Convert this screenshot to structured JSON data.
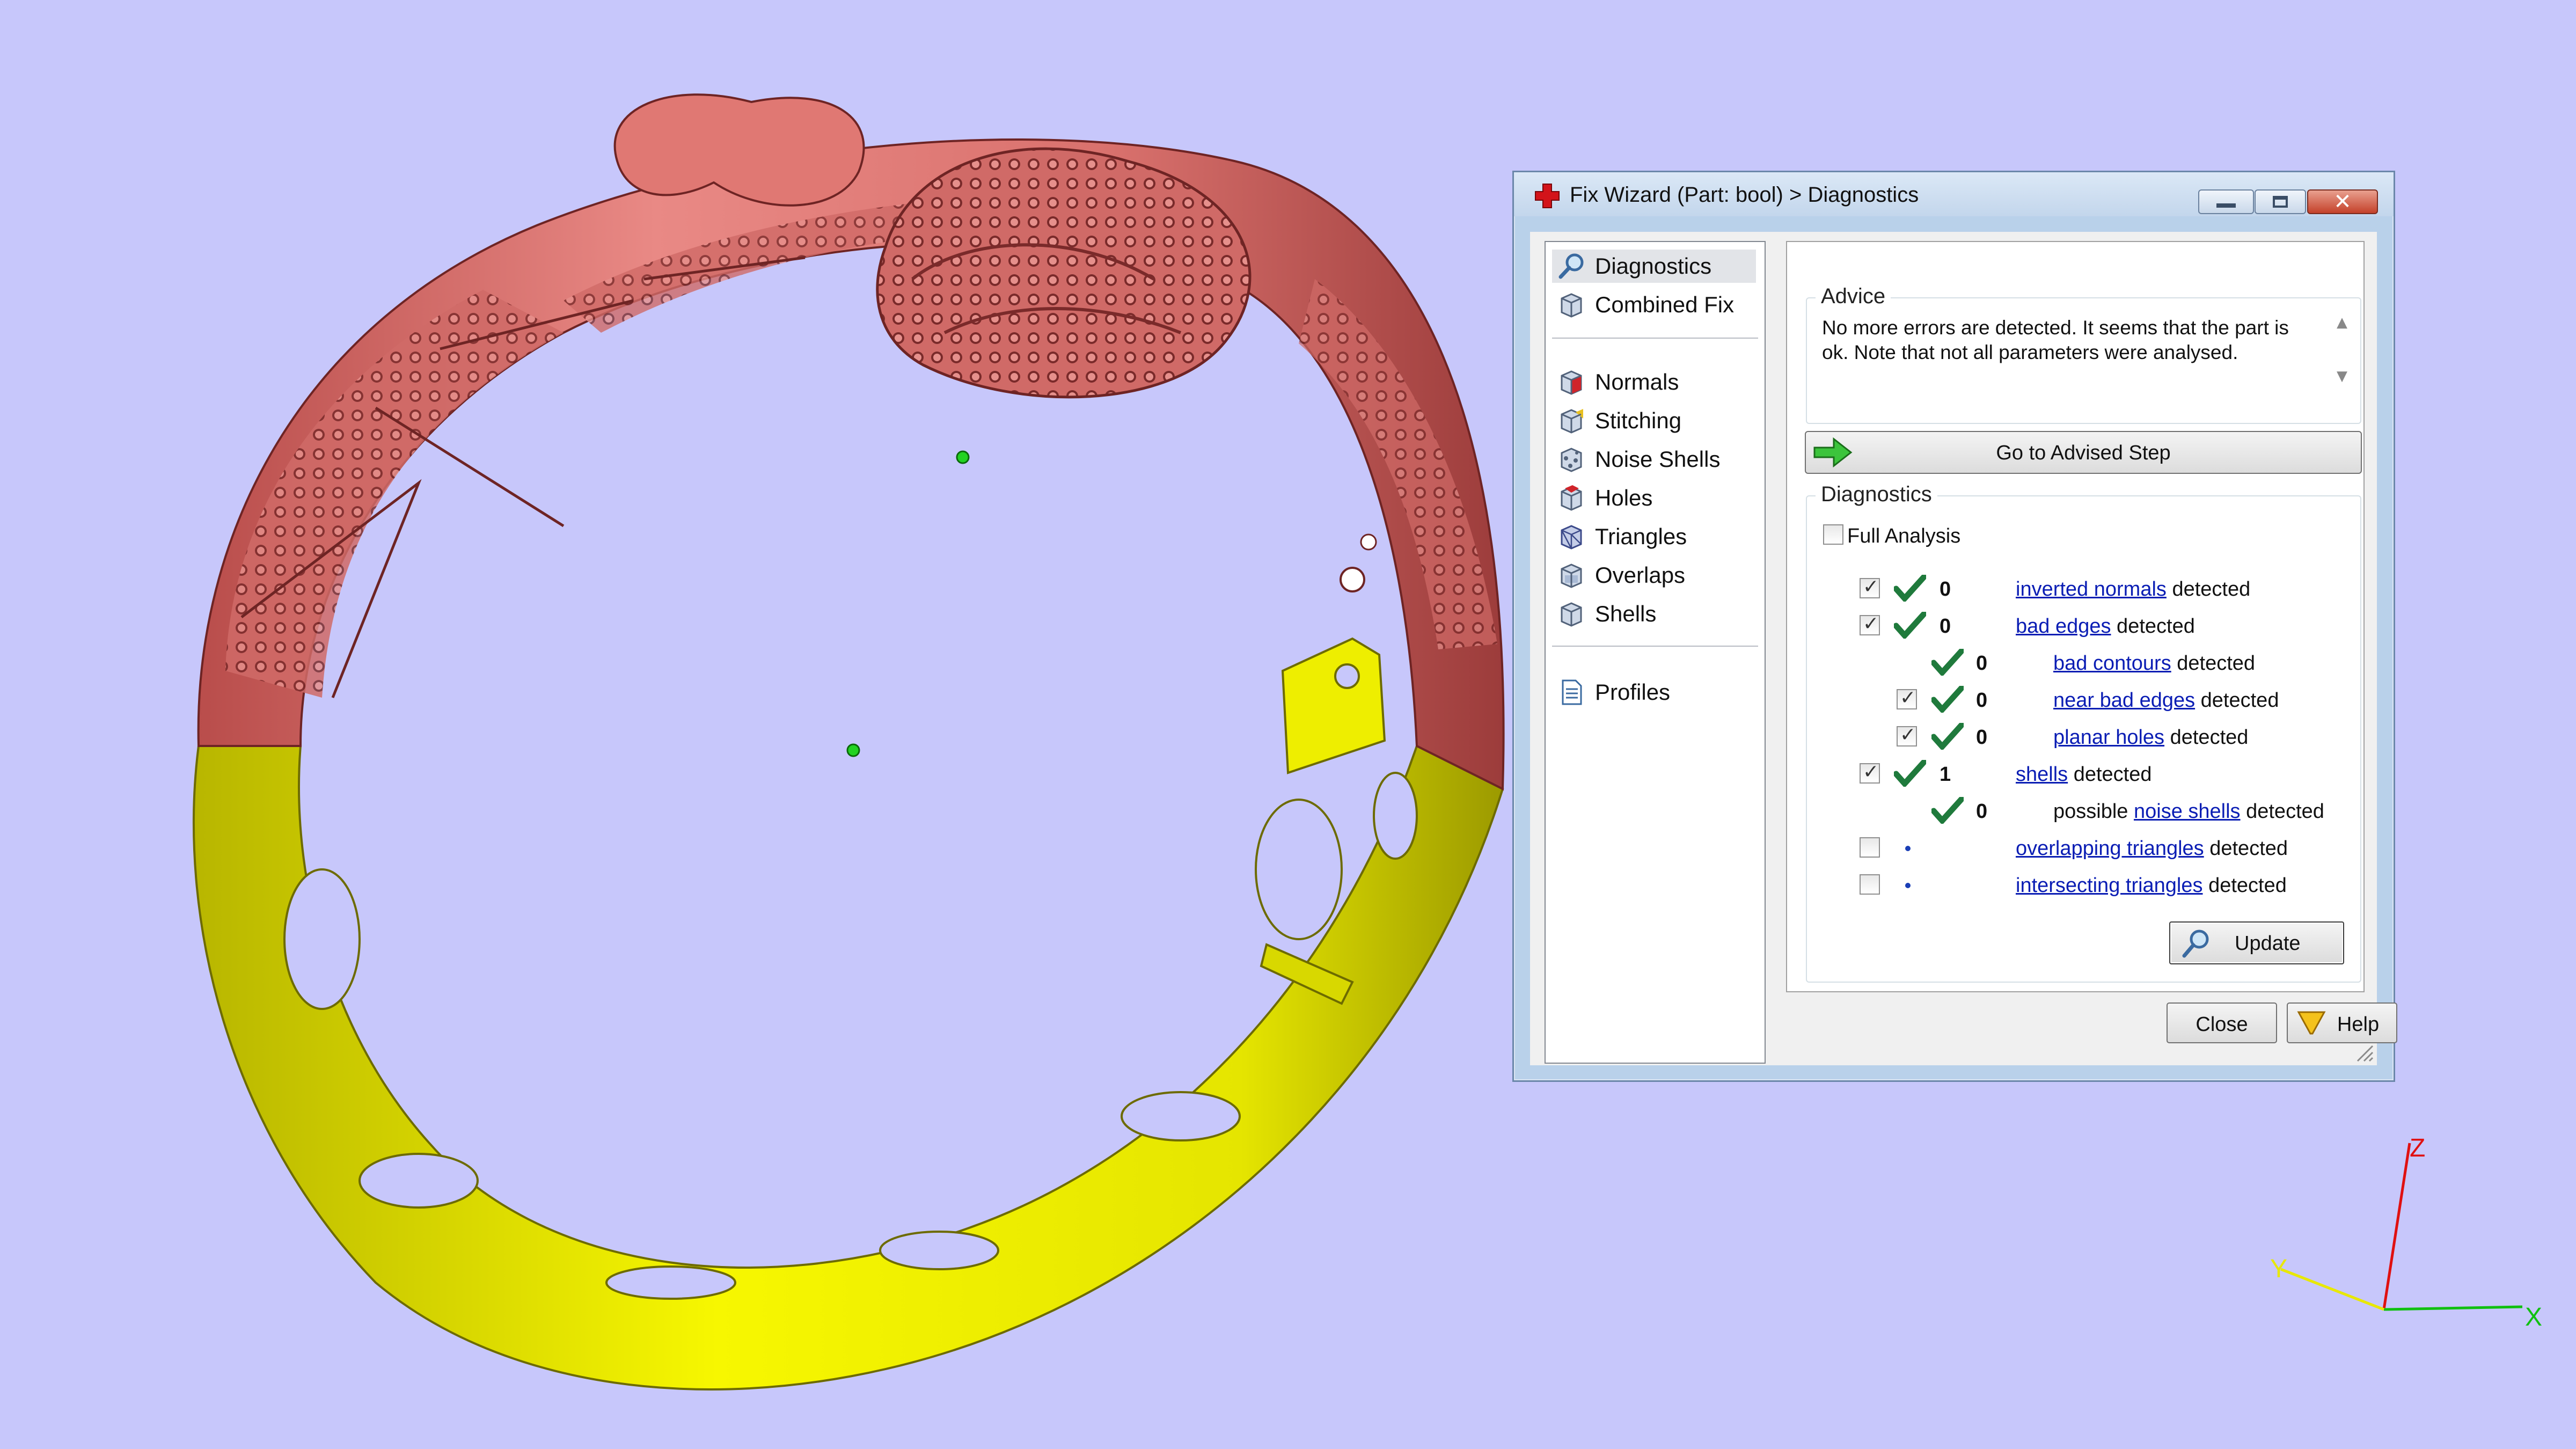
{
  "window": {
    "title": "Fix Wizard (Part: bool) > Diagnostics"
  },
  "nav": {
    "items": [
      {
        "label": "Diagnostics",
        "icon": "magnifier-icon"
      },
      {
        "label": "Combined Fix",
        "icon": "cube-icon"
      },
      {
        "label": "Normals",
        "icon": "normals-cube-icon"
      },
      {
        "label": "Stitching",
        "icon": "stitching-cube-icon"
      },
      {
        "label": "Noise Shells",
        "icon": "noise-shells-icon"
      },
      {
        "label": "Holes",
        "icon": "holes-cube-icon"
      },
      {
        "label": "Triangles",
        "icon": "triangles-cube-icon"
      },
      {
        "label": "Overlaps",
        "icon": "overlaps-cube-icon"
      },
      {
        "label": "Shells",
        "icon": "shells-cube-icon"
      },
      {
        "label": "Profiles",
        "icon": "document-icon"
      }
    ],
    "selected": "Diagnostics"
  },
  "advice": {
    "label": "Advice",
    "text": "No more errors are detected. It seems that the part is ok. Note that not all parameters were analysed."
  },
  "advised_step_button": "Go to Advised Step",
  "diagnostics": {
    "label": "Diagnostics",
    "full_analysis_label": "Full Analysis",
    "full_analysis_checked": false,
    "rows": [
      {
        "checked": true,
        "status": "ok",
        "count": "0",
        "prefix": "",
        "link": "inverted normals",
        "suffix": " detected"
      },
      {
        "checked": true,
        "status": "ok",
        "count": "0",
        "prefix": "",
        "link": "bad edges",
        "suffix": " detected"
      },
      {
        "checked": null,
        "status": "ok",
        "count": "0",
        "prefix": "",
        "link": "bad contours",
        "suffix": " detected"
      },
      {
        "checked": true,
        "status": "ok",
        "count": "0",
        "prefix": "",
        "link": "near bad edges",
        "suffix": " detected"
      },
      {
        "checked": true,
        "status": "ok",
        "count": "0",
        "prefix": "",
        "link": "planar holes",
        "suffix": " detected"
      },
      {
        "checked": true,
        "status": "ok",
        "count": "1",
        "prefix": "",
        "link": "shells",
        "suffix": " detected"
      },
      {
        "checked": null,
        "status": "ok",
        "count": "0",
        "prefix": "possible ",
        "link": "noise shells",
        "suffix": " detected"
      },
      {
        "checked": false,
        "status": "pending",
        "count": "",
        "prefix": "",
        "link": "overlapping triangles",
        "suffix": " detected"
      },
      {
        "checked": false,
        "status": "pending",
        "count": "",
        "prefix": "",
        "link": "intersecting triangles",
        "suffix": " detected"
      }
    ],
    "update_button": "Update"
  },
  "footer": {
    "close_button": "Close",
    "help_button": "Help"
  },
  "axes": {
    "x": "X",
    "y": "Y",
    "z": "Z"
  },
  "colors": {
    "viewport_background": "#c7c7fb",
    "model_upper": "#e07873",
    "model_lower": "#f2f200",
    "link": "#0a1db4",
    "ok_tick": "#1f7a3c"
  }
}
